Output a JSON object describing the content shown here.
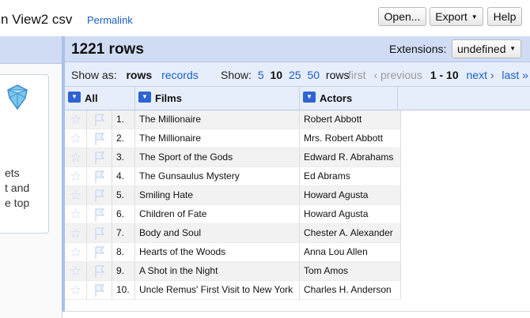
{
  "header": {
    "project_title": "n View2 csv",
    "permalink": "Permalink",
    "open_button": "Open...",
    "export_button": "Export",
    "help_button": "Help"
  },
  "left_panel": {
    "lines": [
      "ets",
      "t and",
      "e top"
    ]
  },
  "grid": {
    "row_count": "1221 rows",
    "extensions_label": "Extensions:",
    "extensions_value": "undefined",
    "show_as_label": "Show as:",
    "show_as_current": "rows",
    "show_as_other": "records",
    "show_label": "Show:",
    "page_sizes": [
      "5",
      "10",
      "25",
      "50"
    ],
    "page_size_current": "10",
    "rows_word": "rows",
    "first": "first",
    "previous": "‹ previous",
    "range": "1 - 10",
    "next": "next ›",
    "last": "last »"
  },
  "columns": {
    "all": "All",
    "films": "Films",
    "actors": "Actors"
  },
  "rows": [
    {
      "idx": "1.",
      "film": "The Millionaire",
      "actor": "Robert Abbott"
    },
    {
      "idx": "2.",
      "film": "The Millionaire",
      "actor": "Mrs. Robert Abbott"
    },
    {
      "idx": "3.",
      "film": "The Sport of the Gods",
      "actor": "Edward R. Abrahams"
    },
    {
      "idx": "4.",
      "film": "The Gunsaulus Mystery",
      "actor": "Ed Abrams"
    },
    {
      "idx": "5.",
      "film": "Smiling Hate",
      "actor": "Howard Agusta"
    },
    {
      "idx": "6.",
      "film": "Children of Fate",
      "actor": "Howard Agusta"
    },
    {
      "idx": "7.",
      "film": "Body and Soul",
      "actor": "Chester A. Alexander"
    },
    {
      "idx": "8.",
      "film": "Hearts of the Woods",
      "actor": "Anna Lou Allen"
    },
    {
      "idx": "9.",
      "film": "A Shot in the Night",
      "actor": "Tom Amos"
    },
    {
      "idx": "10.",
      "film": "Uncle Remus' First Visit to New York",
      "actor": "Charles H. Anderson"
    }
  ]
}
